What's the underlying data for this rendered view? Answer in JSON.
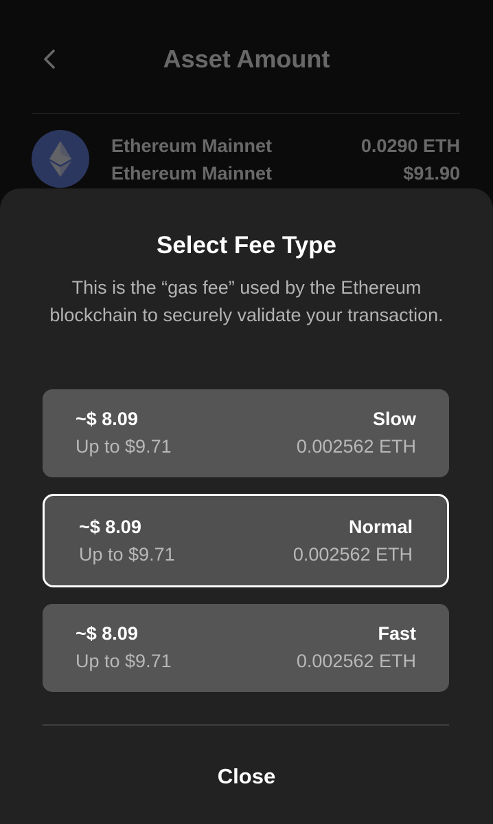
{
  "header": {
    "title": "Asset Amount",
    "back_icon": "chevron-left-icon"
  },
  "asset": {
    "icon": "ethereum-icon",
    "name": "Ethereum Mainnet",
    "network": "Ethereum Mainnet",
    "amount": "0.0290 ETH",
    "fiat": "$91.90"
  },
  "fee_sheet": {
    "title": "Select Fee Type",
    "description": "This is the “gas fee” used by the Ethereum blockchain to securely validate your transaction.",
    "options": [
      {
        "price": "~$ 8.09",
        "up_to": "Up to $9.71",
        "label": "Slow",
        "eth": "0.002562 ETH",
        "selected": false
      },
      {
        "price": "~$ 8.09",
        "up_to": "Up to $9.71",
        "label": "Normal",
        "eth": "0.002562 ETH",
        "selected": true
      },
      {
        "price": "~$ 8.09",
        "up_to": "Up to $9.71",
        "label": "Fast",
        "eth": "0.002562 ETH",
        "selected": false
      }
    ],
    "close_label": "Close"
  },
  "colors": {
    "sheet_bg": "#222222",
    "card_bg": "#555555",
    "selected_border": "#ffffff",
    "eth_brand": "#627eea"
  }
}
